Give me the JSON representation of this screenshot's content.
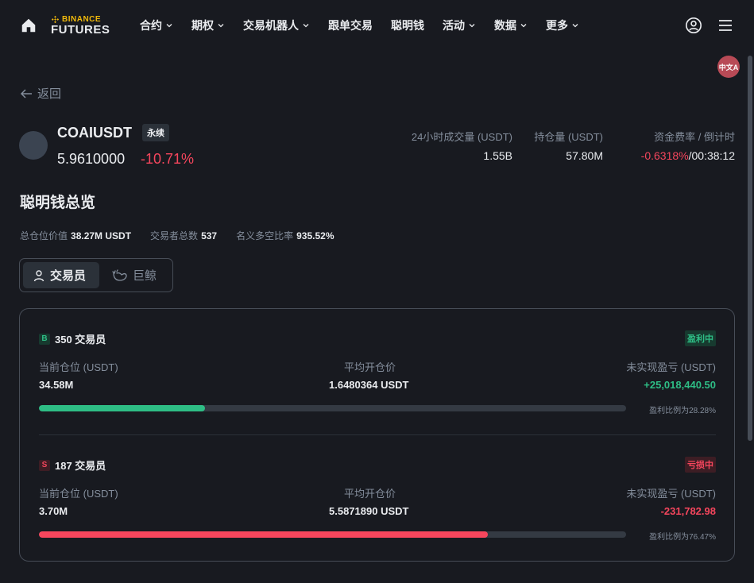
{
  "nav": {
    "logo_top": "BINANCE",
    "logo_bottom": "FUTURES",
    "items": [
      {
        "label": "合约",
        "dropdown": true
      },
      {
        "label": "期权",
        "dropdown": true
      },
      {
        "label": "交易机器人",
        "dropdown": true
      },
      {
        "label": "跟单交易",
        "dropdown": false
      },
      {
        "label": "聪明钱",
        "dropdown": false
      },
      {
        "label": "活动",
        "dropdown": true
      },
      {
        "label": "数据",
        "dropdown": true
      },
      {
        "label": "更多",
        "dropdown": true
      }
    ],
    "translate_label": "中文A"
  },
  "back_label": "返回",
  "symbol": {
    "name": "COAIUSDT",
    "tag": "永续",
    "price": "5.9610000",
    "change": "-10.71%"
  },
  "stats": {
    "volume_label": "24小时成交量 (USDT)",
    "volume_value": "1.55B",
    "oi_label": "持仓量 (USDT)",
    "oi_value": "57.80M",
    "funding_label": "资金费率 / 倒计时",
    "funding_rate": "-0.6318%",
    "funding_sep": "/",
    "funding_countdown": "00:38:12"
  },
  "section": {
    "title": "聪明钱总览",
    "total_label": "总仓位价值",
    "total_value": "38.27M USDT",
    "traders_label": "交易者总数",
    "traders_value": "537",
    "ratio_label": "名义多空比率",
    "ratio_value": "935.52%"
  },
  "tabs": {
    "traders": "交易员",
    "whales": "巨鲸"
  },
  "groups": {
    "long": {
      "side": "B",
      "title": "350 交易员",
      "status": "盈利中",
      "pos_label": "当前仓位 (USDT)",
      "pos_value": "34.58M",
      "avg_label": "平均开仓价",
      "avg_value": "1.6480364 USDT",
      "pnl_label": "未实现盈亏 (USDT)",
      "pnl_value": "+25,018,440.50",
      "ratio_text": "盈利比例为28.28%",
      "ratio_fraction": 0.2828
    },
    "short": {
      "side": "S",
      "title": "187 交易员",
      "status": "亏损中",
      "pos_label": "当前仓位 (USDT)",
      "pos_value": "3.70M",
      "avg_label": "平均开仓价",
      "avg_value": "5.5871890 USDT",
      "pnl_label": "未实现盈亏 (USDT)",
      "pnl_value": "-231,782.98",
      "ratio_text": "盈利比例为76.47%",
      "ratio_fraction": 0.7647
    }
  },
  "colors": {
    "background": "#181a20",
    "positive": "#2ebd85",
    "negative": "#f6465d",
    "brand": "#f0b90b"
  }
}
